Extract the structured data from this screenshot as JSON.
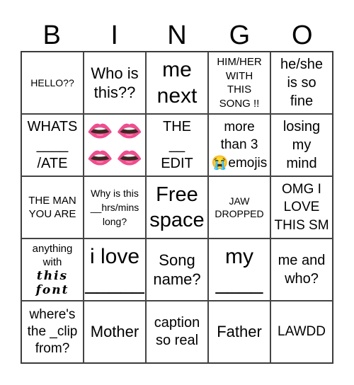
{
  "header": {
    "letters": [
      "B",
      "I",
      "N",
      "G",
      "O"
    ]
  },
  "board": {
    "rows": [
      [
        {
          "text": "HELLO??"
        },
        {
          "text": "Who is\nthis??"
        },
        {
          "text": "me\nnext"
        },
        {
          "text": "HIM/HER\nWITH\nTHIS\nSONG !!"
        },
        {
          "text": "he/she\nis so\nfine"
        }
      ],
      [
        {
          "text": "WHATS\n____\n/ATE"
        },
        {
          "icon": "biting-lip-emoji",
          "glyph": "👄",
          "count": 4
        },
        {
          "text": "THE\n__\nEDIT"
        },
        {
          "text": "more\nthan 3\n😭emojis",
          "icon": "loudly-crying-face-emoji"
        },
        {
          "text": "losing\nmy\nmind"
        }
      ],
      [
        {
          "text": "THE MAN\nYOU ARE"
        },
        {
          "text": "Why is this\n__hrs/mins\nlong?"
        },
        {
          "text": "Free\nspace"
        },
        {
          "text": "JAW\nDROPPED"
        },
        {
          "text": "OMG I\nLOVE\nTHIS SM"
        }
      ],
      [
        {
          "text": "anything\nwith",
          "fancy": "this\nfont"
        },
        {
          "text": "i love\n_____"
        },
        {
          "text": "Song\nname?"
        },
        {
          "text": "my\n____"
        },
        {
          "text": "me and\nwho?"
        }
      ],
      [
        {
          "text": "where's\nthe _clip\nfrom?"
        },
        {
          "text": "Mother"
        },
        {
          "text": "caption\nso real"
        },
        {
          "text": "Father"
        },
        {
          "text": "LAWDD"
        }
      ]
    ]
  }
}
